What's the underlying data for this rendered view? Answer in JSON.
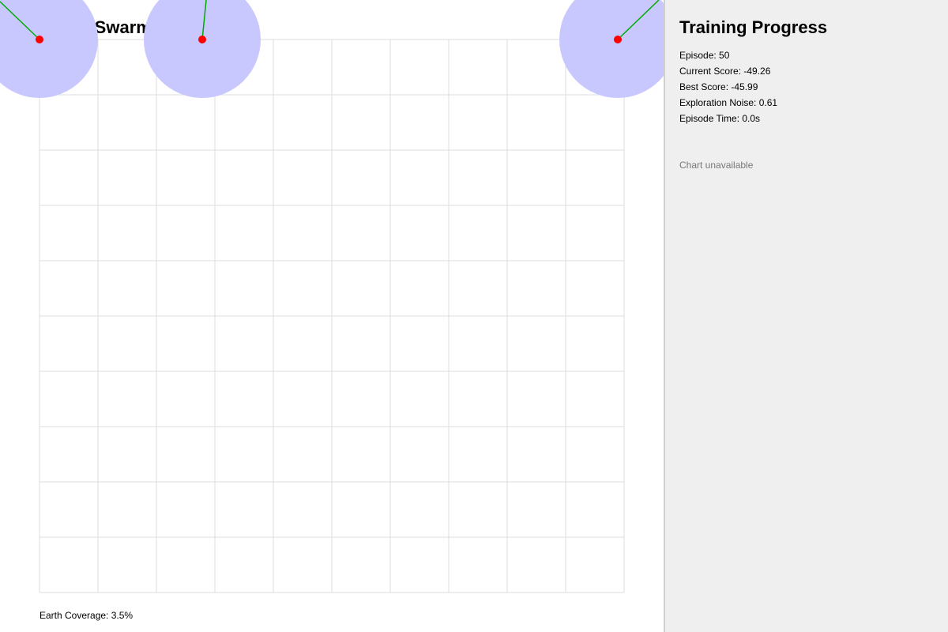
{
  "simulation": {
    "title": "Drone Swarm Simulation",
    "coverage_label": "Earth Coverage: 3.5%",
    "colors": {
      "grid_line": "#dddddd",
      "coverage_circle": "#c8c8ff",
      "drone": "#ff0000",
      "heading": "#00aa00",
      "background": "#ffffff"
    },
    "drones": [
      {
        "name": "drone-1"
      },
      {
        "name": "drone-2"
      },
      {
        "name": "drone-3"
      }
    ]
  },
  "training": {
    "title": "Training Progress",
    "episode": "Episode: 50",
    "current_score": "Current Score: -49.26",
    "best_score": "Best Score: -45.99",
    "exploration_noise": "Exploration Noise: 0.61",
    "episode_time": "Episode Time: 0.0s",
    "chart_status": "Chart unavailable",
    "colors": {
      "panel_background": "#efefef",
      "muted_text": "#777777"
    }
  }
}
